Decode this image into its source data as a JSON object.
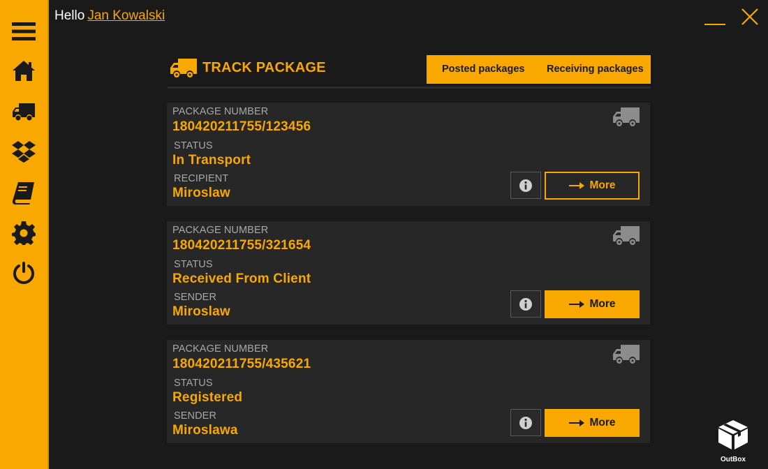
{
  "greeting": {
    "prefix": "Hello",
    "user_name": "Jan Kowalski"
  },
  "sidebar": {
    "items": [
      {
        "icon": "menu-icon"
      },
      {
        "icon": "home-icon"
      },
      {
        "icon": "truck-icon"
      },
      {
        "icon": "dropbox-icon"
      },
      {
        "icon": "book-icon"
      },
      {
        "icon": "gear-icon"
      },
      {
        "icon": "power-icon"
      }
    ]
  },
  "window": {
    "minimize_icon": "minimize-icon",
    "close_icon": "close-icon"
  },
  "header": {
    "title": "TRACK PACKAGE",
    "icon": "truck-icon",
    "tabs": [
      {
        "label": "Posted packages"
      },
      {
        "label": "Receiving packages"
      }
    ]
  },
  "packages": [
    {
      "number_label": "PACKAGE NUMBER",
      "number": "180420211755/123456",
      "status_label": "STATUS",
      "status": "In Transport",
      "party_label": "RECIPIENT",
      "party": "Miroslaw",
      "more_label": "More"
    },
    {
      "number_label": "PACKAGE NUMBER",
      "number": "180420211755/321654",
      "status_label": "STATUS",
      "status": "Received From Client",
      "party_label": "SENDER",
      "party": "Miroslaw",
      "more_label": "More"
    },
    {
      "number_label": "PACKAGE NUMBER",
      "number": "180420211755/435621",
      "status_label": "STATUS",
      "status": "Registered",
      "party_label": "SENDER",
      "party": "Miroslawa",
      "more_label": "More"
    }
  ],
  "brand": {
    "logo_text": "OutBox"
  },
  "colors": {
    "accent": "#f9a800",
    "background": "#1a1a1a",
    "card": "#272727",
    "label": "#a8a8a8"
  }
}
